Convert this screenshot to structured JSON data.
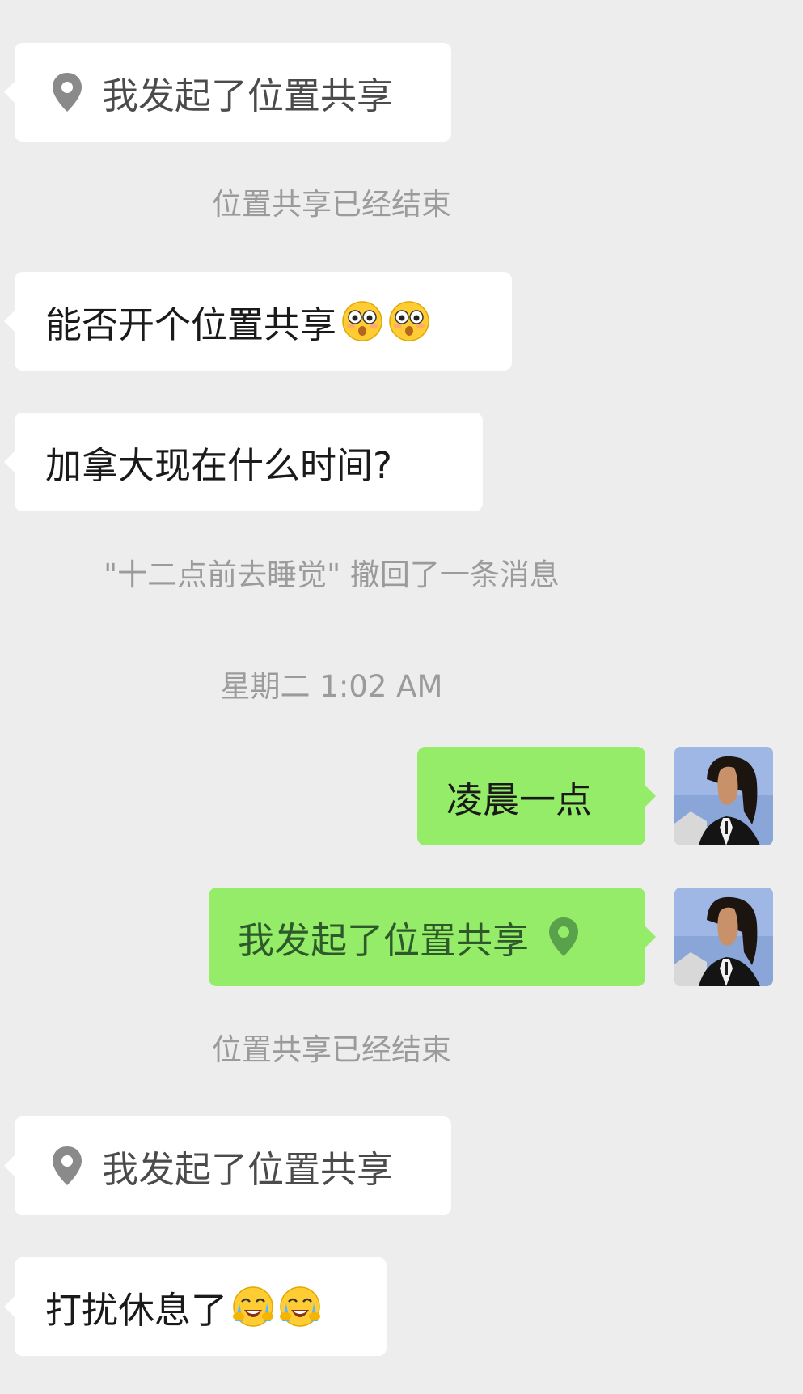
{
  "messages": {
    "m1_text": "我发起了位置共享",
    "s1_text": "位置共享已经结束",
    "m2_text": "能否开个位置共享",
    "m3_text": "加拿大现在什么时间?",
    "s2_text": "\"十二点前去睡觉\" 撤回了一条消息",
    "s3_text": "星期二 1:02 AM",
    "m4_text": "凌晨一点",
    "m5_text": "我发起了位置共享",
    "s4_text": "位置共享已经结束",
    "m6_text": "我发起了位置共享",
    "m7_text": "打扰休息了"
  },
  "icons": {
    "location": "location-pin-icon",
    "flushed": "flushed-face-emoji",
    "crying": "loudly-crying-face-emoji"
  },
  "colors": {
    "background": "#ededed",
    "incoming_bubble": "#ffffff",
    "outgoing_bubble": "#95ec69",
    "system_text": "#9b9b9b"
  }
}
